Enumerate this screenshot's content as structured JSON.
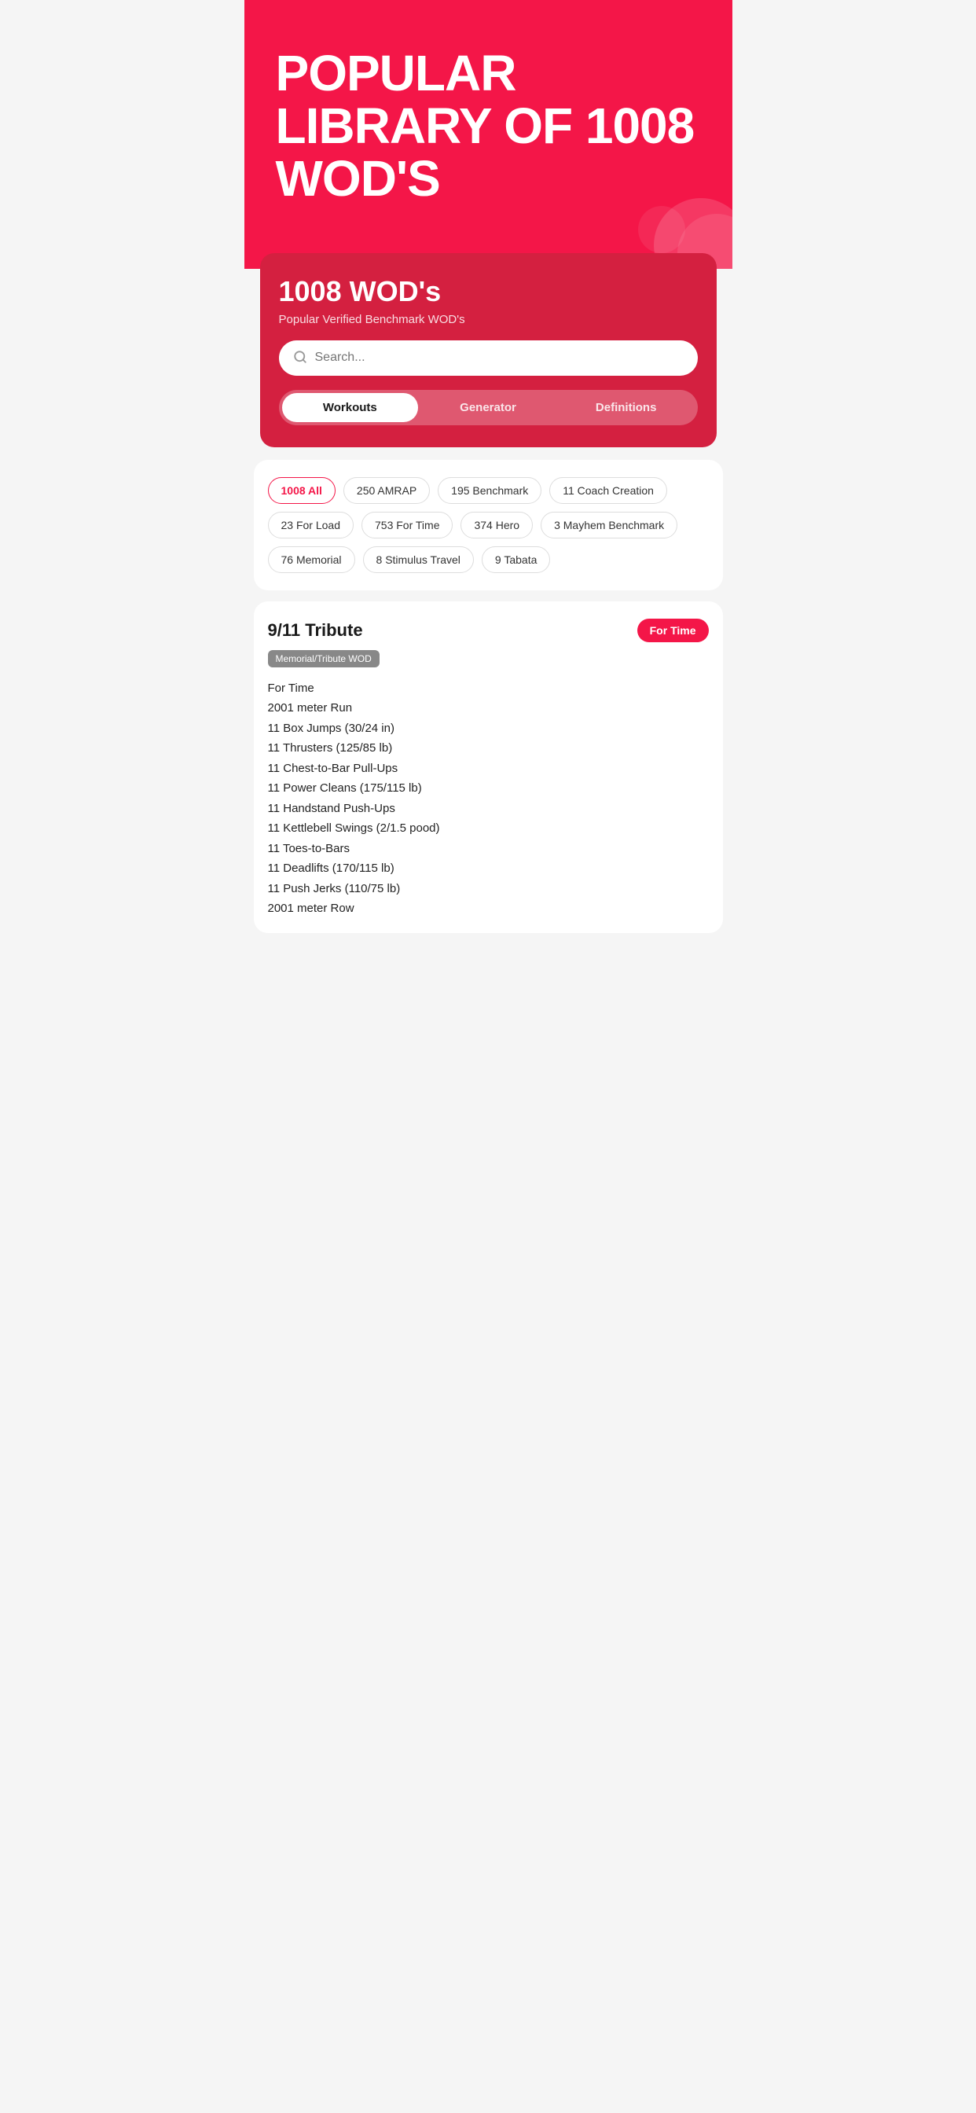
{
  "hero": {
    "title": "POPULAR LIBRARY OF 1008 WOD'S"
  },
  "card": {
    "title": "1008 WOD's",
    "subtitle": "Popular Verified Benchmark WOD's",
    "search_placeholder": "Search..."
  },
  "tabs": [
    {
      "label": "Workouts",
      "active": true
    },
    {
      "label": "Generator",
      "active": false
    },
    {
      "label": "Definitions",
      "active": false
    }
  ],
  "filters": [
    {
      "label": "1008 All",
      "active": true
    },
    {
      "label": "250 AMRAP",
      "active": false
    },
    {
      "label": "195 Benchmark",
      "active": false
    },
    {
      "label": "11 Coach Creation",
      "active": false
    },
    {
      "label": "23 For Load",
      "active": false
    },
    {
      "label": "753 For Time",
      "active": false
    },
    {
      "label": "374 Hero",
      "active": false
    },
    {
      "label": "3 Mayhem Benchmark",
      "active": false
    },
    {
      "label": "76 Memorial",
      "active": false
    },
    {
      "label": "8 Stimulus Travel",
      "active": false
    },
    {
      "label": "9 Tabata",
      "active": false
    }
  ],
  "workout": {
    "title": "9/11 Tribute",
    "type": "For Time",
    "tag": "Memorial/Tribute WOD",
    "description": [
      "For Time",
      "2001 meter Run",
      "11 Box Jumps (30/24 in)",
      "11 Thrusters (125/85 lb)",
      "11 Chest-to-Bar Pull-Ups",
      "11 Power Cleans (175/115 lb)",
      "11 Handstand Push-Ups",
      "11 Kettlebell Swings (2/1.5 pood)",
      "11 Toes-to-Bars",
      "11 Deadlifts (170/115 lb)",
      "11 Push Jerks (110/75 lb)",
      "2001 meter Row"
    ]
  }
}
